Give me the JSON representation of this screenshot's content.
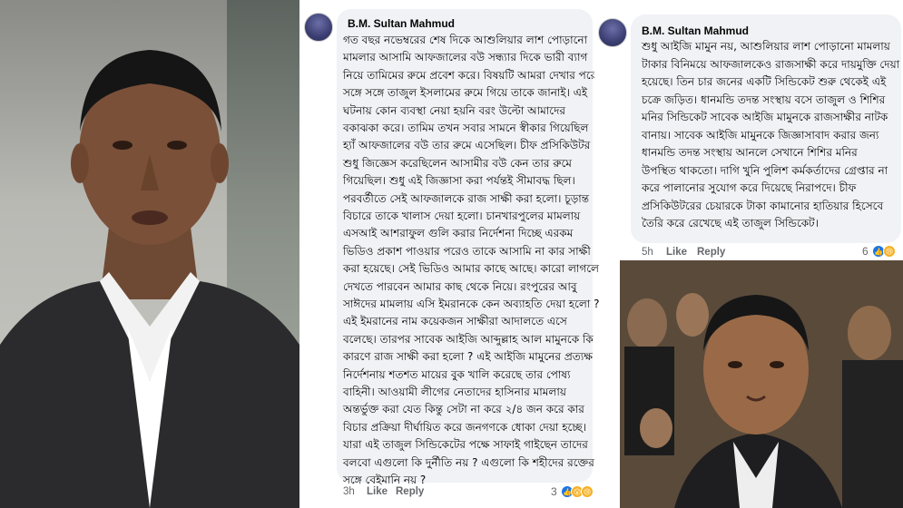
{
  "left_photo": {
    "alt": ""
  },
  "mid_comment": {
    "author": "B.M. Sultan Mahmud",
    "lines": [
      "গত বছর নভেম্বরের শেষ দিকে আশুলিয়ার লাশ পোড়ানো",
      "মামলার আসামি আফজালের বউ সন্ধ্যার দিকে ভারী ব্যাগ",
      "নিয়ে তামিমের রুমে প্রবেশ করে। বিষয়টি আমরা দেখার পরে",
      "সঙ্গে সঙ্গে তাজুল ইসলামের রুমে গিয়ে তাকে জানাই। এই",
      "ঘটনায় কোন ব্যবস্থা নেয়া হয়নি বরং উল্টো আমাদের",
      "বকাঝকা করে। তামিম তখন সবার সামনে স্বীকার গিয়েছিল",
      "হ্যাঁ আফজালের বউ তার রুমে এসেছিল। চীফ প্রসিকিউটর",
      "শুধু জিজ্ঞেস করেছিলেন আসামীর বউ কেন তার রুমে",
      "গিয়েছিল। শুধু এই জিজ্ঞাসা করা পর্যন্তই সীমাবদ্ধ ছিল।",
      "পরবর্তীতে সেই আফজালকে রাজ সাক্ষী করা হলো। চূড়ান্ত",
      "বিচারে তাকে খালাস দেয়া হলো। চানখারপুলের মামলায়",
      "এসআই আশরাফুল গুলি করার নির্দেশনা দিচ্ছে এরকম",
      "ভিডিও প্রকাশ পাওয়ার পরেও তাকে আসামি না কার সাক্ষী",
      "করা হয়েছে। সেই ভিডিও আমার কাছে আছে। কারো লাগলে",
      "দেখতে পারবেন আমার কাছ থেকে নিয়ে। রংপুরের আবু",
      "সাঈদের মামলায় এসি ইমরানকে কেন অব্যাহতি দেয়া হলো ?",
      "এই ইমরানের নাম কয়েকজন সাক্ষীরা আদালতে এসে",
      "বলেছে। তারপর সাবেক আইজি আব্দুল্লাহ আল মামুনকে কি",
      "কারণে রাজ সাক্ষী করা হলো ? এই আইজি মামুনের প্রত্যক্ষ",
      "নির্দেশনায় শতশত মায়ের বুক খালি করেছে তার পোষ্য",
      "বাহিনী। আওয়ামী লীগের নেতাদের হাসিনার মামলায়",
      "অন্তর্ভুক্ত করা যেত কিন্তু সেটা না করে ২/৪ জন করে কার",
      "বিচার প্রক্রিয়া দীর্ঘায়িত করে জনগণকে ধোকা দেয়া হচ্ছে।",
      "যারা এই তাজুল সিন্ডিকেটের পক্ষে সাফাই গাইছেন তাদের",
      "বলবো এগুলো কি দুর্নীতি নয় ? এগুলো কি শহীদের রক্তের",
      "সঙ্গে বেইমানি নয় ?"
    ],
    "time": "3h",
    "like": "Like",
    "reply": "Reply",
    "reaction_count": "3"
  },
  "right_comment": {
    "author": "B.M. Sultan Mahmud",
    "lines": [
      "শুধু আইজি মামুন নয়, আশুলিয়ার লাশ পোড়ানো মামলায়",
      "টাকার বিনিময়ে আফজালকেও রাজসাক্ষী করে দায়মুক্তি দেয়া",
      "হয়েছে। তিন চার জনের একটি সিন্ডিকেট শুরু থেকেই এই",
      "চক্রে জড়িত। ধানমন্ডি তদন্ত সংস্থায় বসে তাজুল ও শিশির",
      "মনির সিন্ডিকেট সাবেক আইজি মামুনকে রাজসাক্ষীর নাটক",
      "বানায়। সাবেক আইজি মামুনকে জিজ্ঞাসাবাদ করার জন্য",
      "ধানমন্ডি তদন্ত সংস্থায় আনলে সেখানে শিশির মনির",
      "উপস্থিত থাকতো। দাগি খুনি পুলিশ কর্মকর্তাদের গ্রেপ্তার না",
      "করে পালানোর সুযোগ করে দিয়েছে নিরাপদে। চীফ",
      "প্রসিকিউটরের চেয়ারকে টাকা কামানোর হাতিয়ার হিসেবে",
      "তৈরি করে রেখেছে এই তাজুল সিন্ডিকেট।"
    ],
    "time": "5h",
    "like": "Like",
    "reply": "Reply",
    "reaction_count": "6"
  },
  "colors": {
    "bubble": "#f0f2f5",
    "text": "#050505",
    "meta": "#65676b",
    "like_blue": "#1b74e4"
  }
}
